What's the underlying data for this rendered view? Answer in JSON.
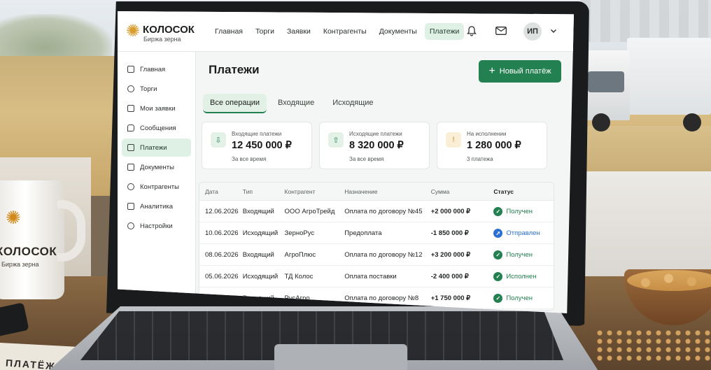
{
  "brand": {
    "name": "КОЛОСОК",
    "subtitle": "Биржа зерна"
  },
  "topnav": {
    "items": [
      {
        "label": "Главная",
        "active": false
      },
      {
        "label": "Торги",
        "active": false
      },
      {
        "label": "Заявки",
        "active": false
      },
      {
        "label": "Контрагенты",
        "active": false
      },
      {
        "label": "Документы",
        "active": false
      },
      {
        "label": "Платежи",
        "active": true
      }
    ],
    "avatar_initials": "ИП"
  },
  "sidebar": {
    "items": [
      {
        "label": "Главная",
        "icon": "home-icon",
        "active": false
      },
      {
        "label": "Торги",
        "icon": "gear-icon",
        "active": false
      },
      {
        "label": "Мои заявки",
        "icon": "clipboard-icon",
        "active": false
      },
      {
        "label": "Сообщения",
        "icon": "chat-icon",
        "active": false
      },
      {
        "label": "Платежи",
        "icon": "payment-icon",
        "active": true
      },
      {
        "label": "Документы",
        "icon": "document-icon",
        "active": false
      },
      {
        "label": "Контрагенты",
        "icon": "users-icon",
        "active": false
      },
      {
        "label": "Аналитика",
        "icon": "chart-icon",
        "active": false
      },
      {
        "label": "Настройки",
        "icon": "settings-icon",
        "active": false
      }
    ]
  },
  "page": {
    "title": "Платежи",
    "new_button": "Новый платёж",
    "tabs": [
      {
        "label": "Все операции",
        "active": true
      },
      {
        "label": "Входящие",
        "active": false
      },
      {
        "label": "Исходящие",
        "active": false
      }
    ]
  },
  "summary": [
    {
      "label": "Входящие платежи",
      "value": "12 450 000 ₽",
      "sub": "За все время",
      "icon": "incoming-icon",
      "color": "#e3f1e7"
    },
    {
      "label": "Исходящие платежи",
      "value": "8 320 000 ₽",
      "sub": "За все время",
      "icon": "outgoing-icon",
      "color": "#e3f1e7"
    },
    {
      "label": "На исполнении",
      "value": "1 280 000 ₽",
      "sub": "3 платежа",
      "icon": "pending-icon",
      "color": "#fbeed6"
    }
  ],
  "table": {
    "headers": [
      "Дата",
      "Тип",
      "Контрагент",
      "Назначение",
      "Сумма",
      "Статус"
    ],
    "rows": [
      {
        "date": "12.06.2026",
        "type": "Входящий",
        "party": "ООО АгроТрейд",
        "purpose": "Оплата по договору №45",
        "amount": "+2 000 000 ₽",
        "status": "Получен",
        "status_color": "#238050"
      },
      {
        "date": "10.06.2026",
        "type": "Исходящий",
        "party": "ЗерноРус",
        "purpose": "Предоплата",
        "amount": "-1 850 000 ₽",
        "status": "Отправлен",
        "status_color": "#2a6fd1"
      },
      {
        "date": "08.06.2026",
        "type": "Входящий",
        "party": "АгроПлюс",
        "purpose": "Оплата по договору №12",
        "amount": "+3 200 000 ₽",
        "status": "Получен",
        "status_color": "#238050"
      },
      {
        "date": "05.06.2026",
        "type": "Исходящий",
        "party": "ТД Колос",
        "purpose": "Оплата поставки",
        "amount": "-2 400 000 ₽",
        "status": "Исполнен",
        "status_color": "#238050"
      },
      {
        "date": "02.06.2026",
        "type": "Входящий",
        "party": "РусАгро",
        "purpose": "Оплата по договору №8",
        "amount": "+1 750 000 ₽",
        "status": "Получен",
        "status_color": "#238050"
      }
    ]
  },
  "mug": {
    "title": "КОЛОСОК",
    "subtitle": "Биржа зерна"
  },
  "paper_text": "ПЛАТЁЖ",
  "colors": {
    "accent": "#238050",
    "nav_active_bg": "#dff0e4"
  }
}
